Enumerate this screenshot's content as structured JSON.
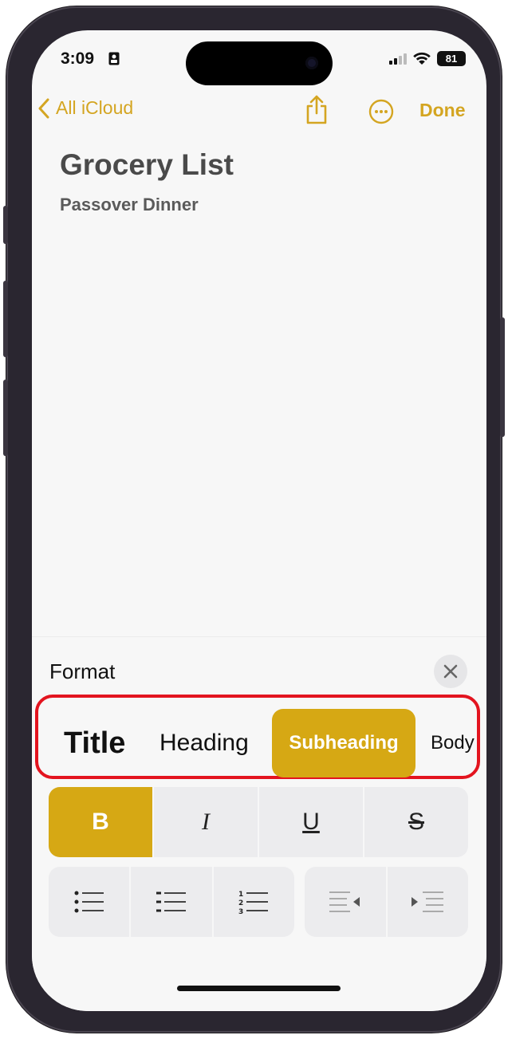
{
  "status_bar": {
    "time": "3:09",
    "battery": "81"
  },
  "nav": {
    "back_label": "All iCloud",
    "done_label": "Done"
  },
  "note": {
    "title": "Grocery List",
    "subtitle": "Passover Dinner"
  },
  "format_panel": {
    "label": "Format",
    "paragraph_styles": [
      {
        "label": "Title",
        "selected": false
      },
      {
        "label": "Heading",
        "selected": false
      },
      {
        "label": "Subheading",
        "selected": true
      },
      {
        "label": "Body",
        "selected": false
      }
    ],
    "text_styles": [
      {
        "label": "B",
        "active": true
      },
      {
        "label": "I",
        "active": false
      },
      {
        "label": "U",
        "active": false
      },
      {
        "label": "S",
        "active": false
      }
    ]
  },
  "colors": {
    "accent": "#d4a521",
    "selected_fill": "#d6a814",
    "highlight_border": "#e3141f"
  }
}
